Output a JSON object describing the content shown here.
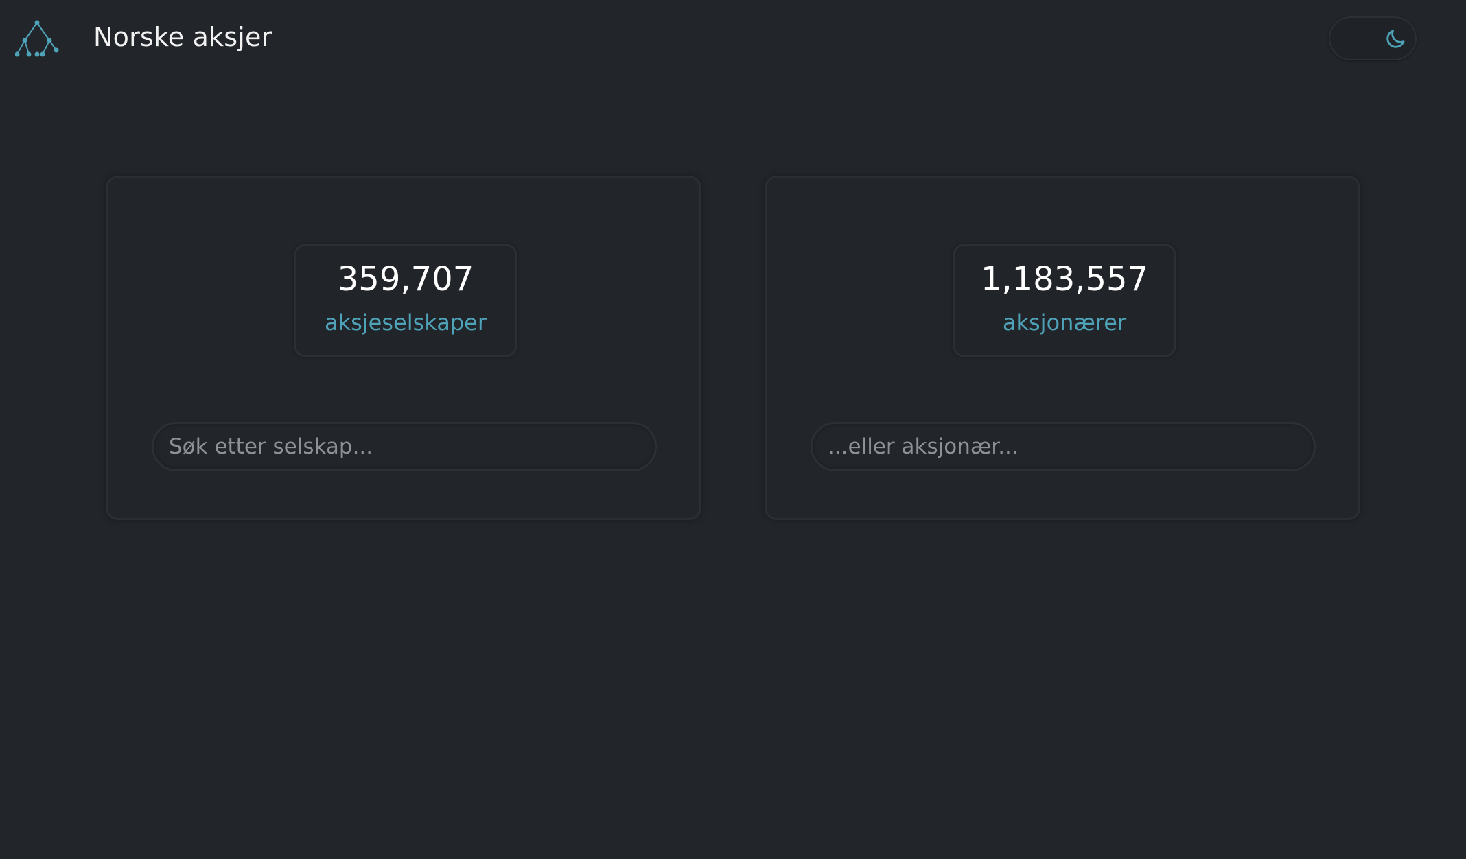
{
  "header": {
    "logo_icon": "tree-network-icon",
    "title": "Norske aksjer",
    "theme_toggle_icon": "moon-icon"
  },
  "companies": {
    "count": "359,707",
    "label": "aksjeselskaper",
    "search_placeholder": "Søk etter selskap..."
  },
  "shareholders": {
    "count": "1,183,557",
    "label": "aksjonærer",
    "search_placeholder": "...eller aksjonær..."
  },
  "colors": {
    "background": "#222529",
    "accent": "#4fa3b8",
    "border": "#2c3035",
    "text": "#ffffff"
  }
}
